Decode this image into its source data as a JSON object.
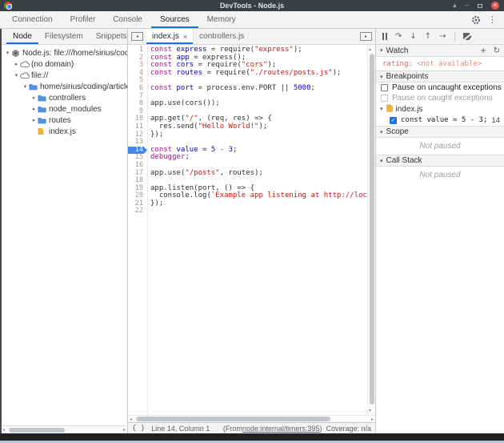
{
  "window": {
    "title": "DevTools - Node.js"
  },
  "main_tabs": {
    "items": [
      "Connection",
      "Profiler",
      "Console",
      "Sources",
      "Memory"
    ],
    "active": "Sources"
  },
  "left_panel": {
    "tabs": [
      "Node",
      "Filesystem",
      "Snippets"
    ],
    "active_tab": "Node",
    "tree": [
      {
        "label": "Node.js: file:///home/sirius/coding/a",
        "icon": "node",
        "arrow": "expanded",
        "level": 0
      },
      {
        "label": "(no domain)",
        "icon": "cloud",
        "arrow": "collapsed",
        "level": 1
      },
      {
        "label": "file://",
        "icon": "cloud",
        "arrow": "expanded",
        "level": 1
      },
      {
        "label": "home/sirius/coding/article-proje",
        "icon": "folder",
        "arrow": "expanded",
        "level": 2
      },
      {
        "label": "controllers",
        "icon": "folder",
        "arrow": "collapsed",
        "level": 3
      },
      {
        "label": "node_modules",
        "icon": "folder",
        "arrow": "collapsed",
        "level": 3
      },
      {
        "label": "routes",
        "icon": "folder",
        "arrow": "collapsed",
        "level": 3
      },
      {
        "label": "index.js",
        "icon": "file",
        "arrow": "none",
        "level": 3
      }
    ]
  },
  "editor": {
    "tabs": [
      {
        "label": "index.js",
        "active": true,
        "closable": true
      },
      {
        "label": "controllers.js",
        "active": false,
        "closable": false
      }
    ],
    "breakpoint_line": 14,
    "lines": [
      {
        "n": 1,
        "t": [
          [
            "kw",
            "const"
          ],
          [
            "pl",
            " "
          ],
          [
            "def",
            "express"
          ],
          [
            "pl",
            " = require("
          ],
          [
            "str",
            "\"express\""
          ],
          [
            "pl",
            ");"
          ]
        ]
      },
      {
        "n": 2,
        "t": [
          [
            "kw",
            "const"
          ],
          [
            "pl",
            " "
          ],
          [
            "def",
            "app"
          ],
          [
            "pl",
            " = express();"
          ]
        ]
      },
      {
        "n": 3,
        "t": [
          [
            "kw",
            "const"
          ],
          [
            "pl",
            " "
          ],
          [
            "def",
            "cors"
          ],
          [
            "pl",
            " = require("
          ],
          [
            "str",
            "\"cors\""
          ],
          [
            "pl",
            ");"
          ]
        ]
      },
      {
        "n": 4,
        "t": [
          [
            "kw",
            "const"
          ],
          [
            "pl",
            " "
          ],
          [
            "def",
            "routes"
          ],
          [
            "pl",
            " = require("
          ],
          [
            "str",
            "\"./routes/posts.js\""
          ],
          [
            "pl",
            ");"
          ]
        ]
      },
      {
        "n": 5,
        "t": []
      },
      {
        "n": 6,
        "t": [
          [
            "kw",
            "const"
          ],
          [
            "pl",
            " "
          ],
          [
            "def",
            "port"
          ],
          [
            "pl",
            " = process.env.PORT || "
          ],
          [
            "num",
            "5000"
          ],
          [
            "pl",
            ";"
          ]
        ]
      },
      {
        "n": 7,
        "t": []
      },
      {
        "n": 8,
        "t": [
          [
            "pl",
            "app.use(cors());"
          ]
        ]
      },
      {
        "n": 9,
        "t": []
      },
      {
        "n": 10,
        "t": [
          [
            "pl",
            "app.get("
          ],
          [
            "str",
            "\"/\""
          ],
          [
            "pl",
            ", (req, res) => {"
          ]
        ]
      },
      {
        "n": 11,
        "t": [
          [
            "pl",
            "  res.send("
          ],
          [
            "str",
            "\"Hello World!\""
          ],
          [
            "pl",
            ");"
          ]
        ]
      },
      {
        "n": 12,
        "t": [
          [
            "pl",
            "});"
          ]
        ]
      },
      {
        "n": 13,
        "t": []
      },
      {
        "n": 14,
        "t": [
          [
            "kw",
            "const"
          ],
          [
            "pl",
            " "
          ],
          [
            "def",
            "value"
          ],
          [
            "pl",
            " = "
          ],
          [
            "num",
            "5"
          ],
          [
            "pl",
            " - "
          ],
          [
            "num",
            "3"
          ],
          [
            "pl",
            ";"
          ]
        ]
      },
      {
        "n": 15,
        "t": [
          [
            "kw",
            "debugger"
          ],
          [
            "pl",
            ";"
          ]
        ]
      },
      {
        "n": 16,
        "t": []
      },
      {
        "n": 17,
        "t": [
          [
            "pl",
            "app.use("
          ],
          [
            "str",
            "\"/posts\""
          ],
          [
            "pl",
            ", routes);"
          ]
        ]
      },
      {
        "n": 18,
        "t": []
      },
      {
        "n": 19,
        "t": [
          [
            "pl",
            "app.listen(port, () => {"
          ]
        ]
      },
      {
        "n": 20,
        "t": [
          [
            "pl",
            "  console.log("
          ],
          [
            "str",
            "`Example app listening at http://localhost:"
          ]
        ]
      },
      {
        "n": 21,
        "t": [
          [
            "pl",
            "});"
          ]
        ]
      },
      {
        "n": 22,
        "t": []
      }
    ],
    "status": {
      "pretty_print": "{ }",
      "line_col": "Line 14, Column 1",
      "from_prefix": "(From ",
      "from_link": "node:internal/timers:395",
      "from_suffix": ")",
      "coverage": "Coverage: n/a"
    }
  },
  "debugger_panel": {
    "toolbar_icons": [
      "pause",
      "step-over",
      "step-into",
      "step-out",
      "step",
      "deactivate-breakpoints"
    ],
    "watch": {
      "title": "Watch",
      "name": "rating:",
      "value": "<not available>"
    },
    "breakpoints": {
      "title": "Breakpoints",
      "pause_uncaught": "Pause on uncaught exceptions",
      "pause_caught": "Pause on caught exceptions",
      "file": "index.js",
      "entry_code": "const value = 5 - 3;",
      "entry_line": "14"
    },
    "scope": {
      "title": "Scope",
      "empty": "Not paused"
    },
    "call_stack": {
      "title": "Call Stack",
      "empty": "Not paused"
    }
  },
  "icons": {
    "kebab": "⋮",
    "close": "×",
    "plus": "+",
    "refresh": "↻",
    "step_over": "↷",
    "step_into": "↓",
    "step_out": "↑",
    "step": "→",
    "collapsed": "▸",
    "expanded": "▾",
    "shade": "▴",
    "minimize": "−",
    "scroll_up": "▴",
    "scroll_down": "▾",
    "scroll_left": "◂",
    "scroll_right": "▸",
    "check": "✓",
    "toggle_left": "◂",
    "toggle_right": "▸"
  },
  "colors": {
    "accent": "#1a73e8",
    "breakpoint": "#4486f0",
    "keyword": "#aa0d91",
    "string": "#c41a16",
    "number": "#1c00cf",
    "definition": "#0000c0",
    "watch_text": "#d5604b",
    "titlebar": "#3b3e42",
    "close_button": "#dd5b55",
    "folder": "#5291e0",
    "file": "#f0b03c"
  }
}
